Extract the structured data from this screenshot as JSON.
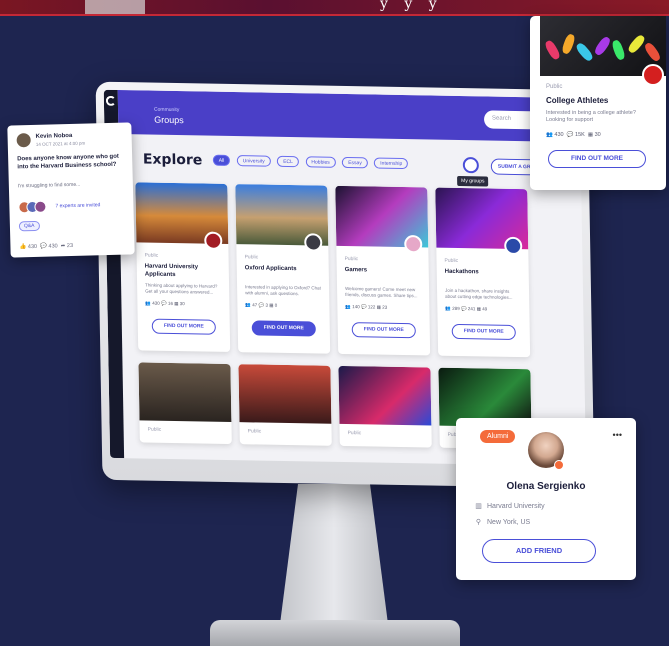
{
  "banner": {
    "text": "y y y"
  },
  "app": {
    "community_label": "Community",
    "groups_title": "Groups",
    "search_placeholder": "Search",
    "explore_title": "Explore",
    "filters": [
      "All",
      "University",
      "ECL",
      "Hobbies",
      "Essay",
      "Internship"
    ],
    "submit_label": "SUBMIT A GRO",
    "my_groups_tooltip": "My groups"
  },
  "cards": [
    {
      "public": "Public",
      "title": "Harvard University Applicants",
      "desc": "Thinking about applying to Harvard? Get all your questions answered...",
      "members": "430",
      "posts": "16",
      "events": "30",
      "button": "FIND OUT MORE"
    },
    {
      "public": "Public",
      "title": "Oxford Applicants",
      "desc": "Interested in applying to Oxford? Chat with alumni, ask questions.",
      "members": "47",
      "posts": "3",
      "events": "0",
      "button": "FIND OUT MORE"
    },
    {
      "public": "Public",
      "title": "Gamers",
      "desc": "Welcome gamers! Come meet new friends, discuss games. Share tips...",
      "members": "140",
      "posts": "122",
      "events": "23",
      "button": "FIND OUT MORE"
    },
    {
      "public": "Public",
      "title": "Hackathons",
      "desc": "Join a hackathon, share insights about cutting edge technologies...",
      "members": "289",
      "posts": "241",
      "events": "49",
      "button": "FIND OUT MORE"
    }
  ],
  "row2_cards": [
    {
      "public": "Public"
    },
    {
      "public": "Public"
    },
    {
      "public": "Public"
    },
    {
      "public": "Public"
    }
  ],
  "post_card": {
    "author": "Kevin Noboa",
    "date": "14 OCT 2021 at 4:00 pm",
    "question": "Does anyone know anyone who got into the Harvard Business school?",
    "body": "I'm struggling to find some...",
    "experts": "7 experts are invited",
    "tag": "Q&A",
    "likes": "430",
    "comments": "430",
    "shares": "23"
  },
  "athletes_card": {
    "public": "Public",
    "title": "College Athletes",
    "desc": "Interested in being a college athlete? Looking for support",
    "members": "430",
    "posts": "15K",
    "events": "30",
    "button": "FIND OUT MORE"
  },
  "profile_card": {
    "tag": "Alumni",
    "name": "Olena Sergienko",
    "school": "Harvard University",
    "location": "New York, US",
    "button": "ADD FRIEND"
  },
  "colors": {
    "accent": "#4a4fd8",
    "header": "#4a3fc7",
    "background": "#1e2550",
    "alumni": "#f46b3a"
  },
  "icons": [
    "home-icon",
    "search-icon",
    "members-icon",
    "chat-icon",
    "calendar-icon",
    "like-icon",
    "comment-icon",
    "share-icon",
    "university-icon",
    "location-icon",
    "more-icon"
  ]
}
